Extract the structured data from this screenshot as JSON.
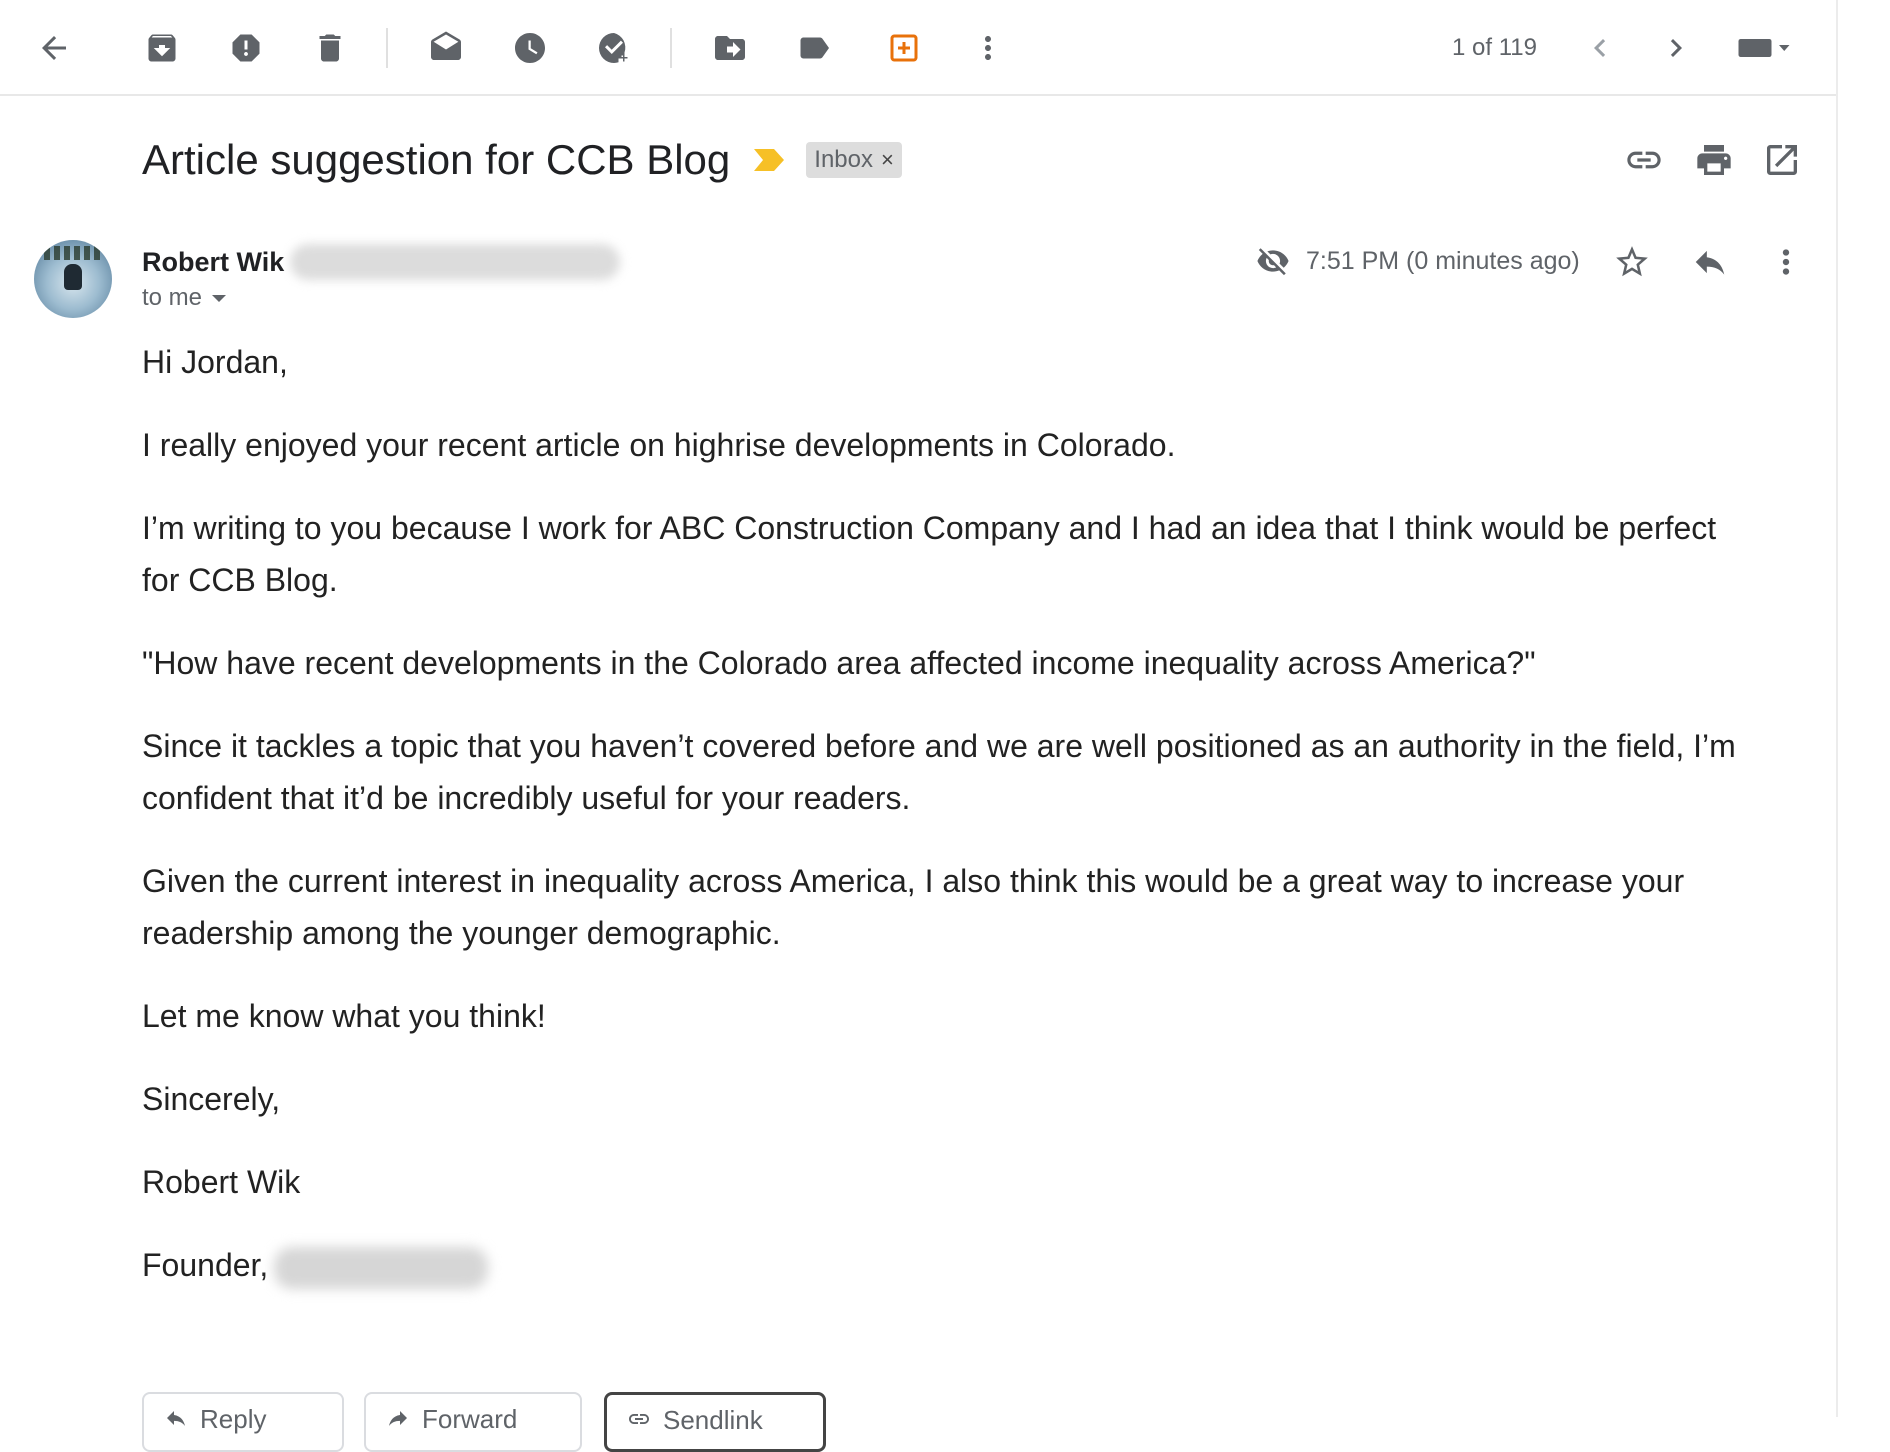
{
  "toolbar": {
    "icons": [
      "back-arrow-icon",
      "archive-icon",
      "report-spam-icon",
      "delete-icon",
      "mark-unread-icon",
      "snooze-icon",
      "add-to-tasks-icon",
      "move-to-icon",
      "labels-icon",
      "addon-icon",
      "more-vert-icon"
    ],
    "pager": "1 of 119",
    "accent_color": "#e8710a"
  },
  "message": {
    "subject": "Article suggestion for CCB Blog",
    "label": "Inbox",
    "label_remove": "×",
    "importance_color": "#f6c026",
    "sender_name": "Robert Wik",
    "recipient": "to me",
    "time": "7:51 PM (0 minutes ago)"
  },
  "body": {
    "greeting": "Hi Jordan,",
    "p1": "I really enjoyed your recent article on highrise developments in Colorado.",
    "p2": "I’m writing to you because I work for ABC Construction Company and I had an idea that I think would be perfect for CCB Blog.",
    "p3": "\"How have recent developments in the Colorado area affected income inequality across America?\"",
    "p4": "Since it tackles a topic that you haven’t covered before and we are well positioned as an authority in the field, I’m confident that it’d be incredibly useful for your readers.",
    "p5": "Given the current interest in inequality across America, I also think this would be a great way to increase your readership among the younger demographic.",
    "p6": "Let me know what you think!",
    "closing": "Sincerely,",
    "signature_name": "Robert Wik",
    "signature_title": "Founder,"
  },
  "actions": {
    "reply": "Reply",
    "forward": "Forward",
    "third": "Sendlink"
  }
}
